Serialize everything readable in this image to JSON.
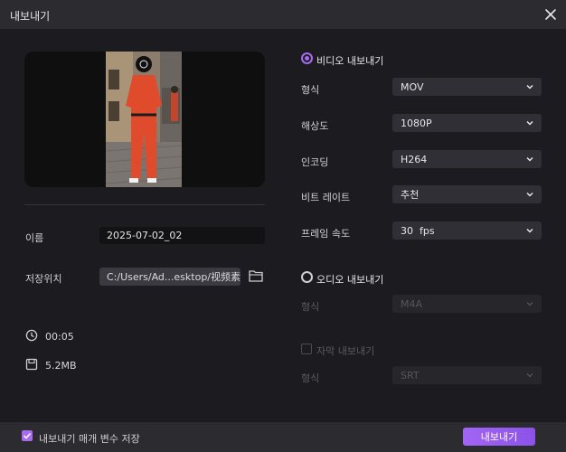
{
  "window": {
    "title": "내보내기"
  },
  "left": {
    "name_label": "이름",
    "name_value": "2025-07-02_02",
    "save_label": "저장위치",
    "save_path": "C:/Users/Ad...esktop/视频素材",
    "duration": "00:05",
    "size": "5.2MB"
  },
  "video": {
    "section_label": "비디오 내보내기",
    "rows": [
      {
        "label": "형식",
        "value": "MOV"
      },
      {
        "label": "해상도",
        "value": "1080P"
      },
      {
        "label": "인코딩",
        "value": "H264"
      },
      {
        "label": "비트 레이트",
        "value": "추천"
      },
      {
        "label": "프레임 속도",
        "value": "30  fps"
      }
    ]
  },
  "audio": {
    "section_label": "오디오 내보내기",
    "format_label": "형식",
    "format_value": "M4A"
  },
  "subtitle": {
    "section_label": "자막 내보내기",
    "format_label": "형식",
    "format_value": "SRT"
  },
  "footer": {
    "save_params_label": "내보내기 매개 변수 저장",
    "export_button": "내보내기"
  },
  "colors": {
    "accent": "#a86bf0",
    "background": "#1c1c20",
    "titlebar": "#2b2b30"
  }
}
